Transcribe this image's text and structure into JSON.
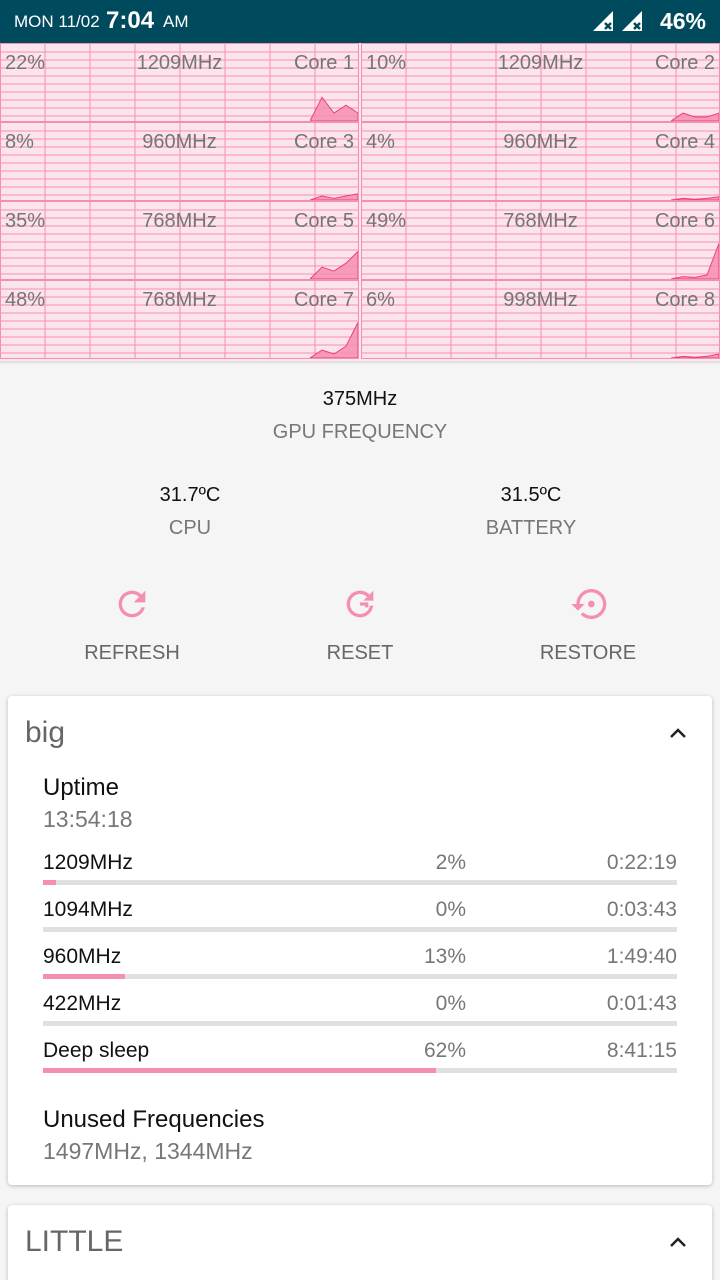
{
  "status_bar": {
    "date": "MON 11/02",
    "time": "7:04",
    "ampm": "AM",
    "battery": "46%",
    "icons": [
      "signal-no-data-icon",
      "signal-no-data-icon"
    ]
  },
  "cores": [
    {
      "name": "Core 1",
      "usage": "22%",
      "freq": "1209MHz",
      "graph": [
        0,
        0,
        0,
        0,
        0,
        0,
        0,
        0,
        0.3,
        0.1,
        0.2,
        0.1
      ]
    },
    {
      "name": "Core 2",
      "usage": "10%",
      "freq": "1209MHz",
      "graph": [
        0,
        0,
        0,
        0,
        0,
        0,
        0,
        0,
        0.1,
        0.05,
        0.05,
        0.1
      ]
    },
    {
      "name": "Core 3",
      "usage": "8%",
      "freq": "960MHz",
      "graph": [
        0,
        0,
        0,
        0,
        0,
        0,
        0,
        0,
        0.05,
        0.02,
        0.05,
        0.08
      ]
    },
    {
      "name": "Core 4",
      "usage": "4%",
      "freq": "960MHz",
      "graph": [
        0,
        0,
        0,
        0,
        0,
        0,
        0,
        0,
        0.02,
        0.01,
        0.02,
        0.04
      ]
    },
    {
      "name": "Core 5",
      "usage": "35%",
      "freq": "768MHz",
      "graph": [
        0,
        0,
        0,
        0,
        0,
        0,
        0,
        0,
        0.15,
        0.1,
        0.2,
        0.35
      ]
    },
    {
      "name": "Core 6",
      "usage": "49%",
      "freq": "768MHz",
      "graph": [
        0,
        0,
        0,
        0,
        0,
        0,
        0,
        0,
        0.03,
        0.02,
        0.05,
        0.45
      ]
    },
    {
      "name": "Core 7",
      "usage": "48%",
      "freq": "768MHz",
      "graph": [
        0,
        0,
        0,
        0,
        0,
        0,
        0,
        0,
        0.1,
        0.05,
        0.15,
        0.45
      ]
    },
    {
      "name": "Core 8",
      "usage": "6%",
      "freq": "998MHz",
      "graph": [
        0,
        0,
        0,
        0,
        0,
        0,
        0,
        0,
        0.02,
        0.01,
        0.02,
        0.05
      ]
    }
  ],
  "gpu": {
    "value": "375MHz",
    "label": "GPU FREQUENCY"
  },
  "temps": {
    "cpu": {
      "value": "31.7ºC",
      "label": "CPU"
    },
    "battery": {
      "value": "31.5ºC",
      "label": "BATTERY"
    }
  },
  "actions": {
    "refresh": "REFRESH",
    "reset": "RESET",
    "restore": "RESTORE"
  },
  "big": {
    "title": "big",
    "uptime_label": "Uptime",
    "uptime_value": "13:54:18",
    "states": [
      {
        "freq": "1209MHz",
        "percent": "2%",
        "time": "0:22:19",
        "fraction": 0.02
      },
      {
        "freq": "1094MHz",
        "percent": "0%",
        "time": "0:03:43",
        "fraction": 0.0
      },
      {
        "freq": "960MHz",
        "percent": "13%",
        "time": "1:49:40",
        "fraction": 0.13
      },
      {
        "freq": "422MHz",
        "percent": "0%",
        "time": "0:01:43",
        "fraction": 0.0
      },
      {
        "freq": "Deep sleep",
        "percent": "62%",
        "time": "8:41:15",
        "fraction": 0.62
      }
    ],
    "unused_label": "Unused Frequencies",
    "unused_value": "1497MHz, 1344MHz"
  },
  "little": {
    "title": "LITTLE"
  },
  "colors": {
    "accent": "#f48fb1",
    "statusbar": "#004a5e"
  }
}
